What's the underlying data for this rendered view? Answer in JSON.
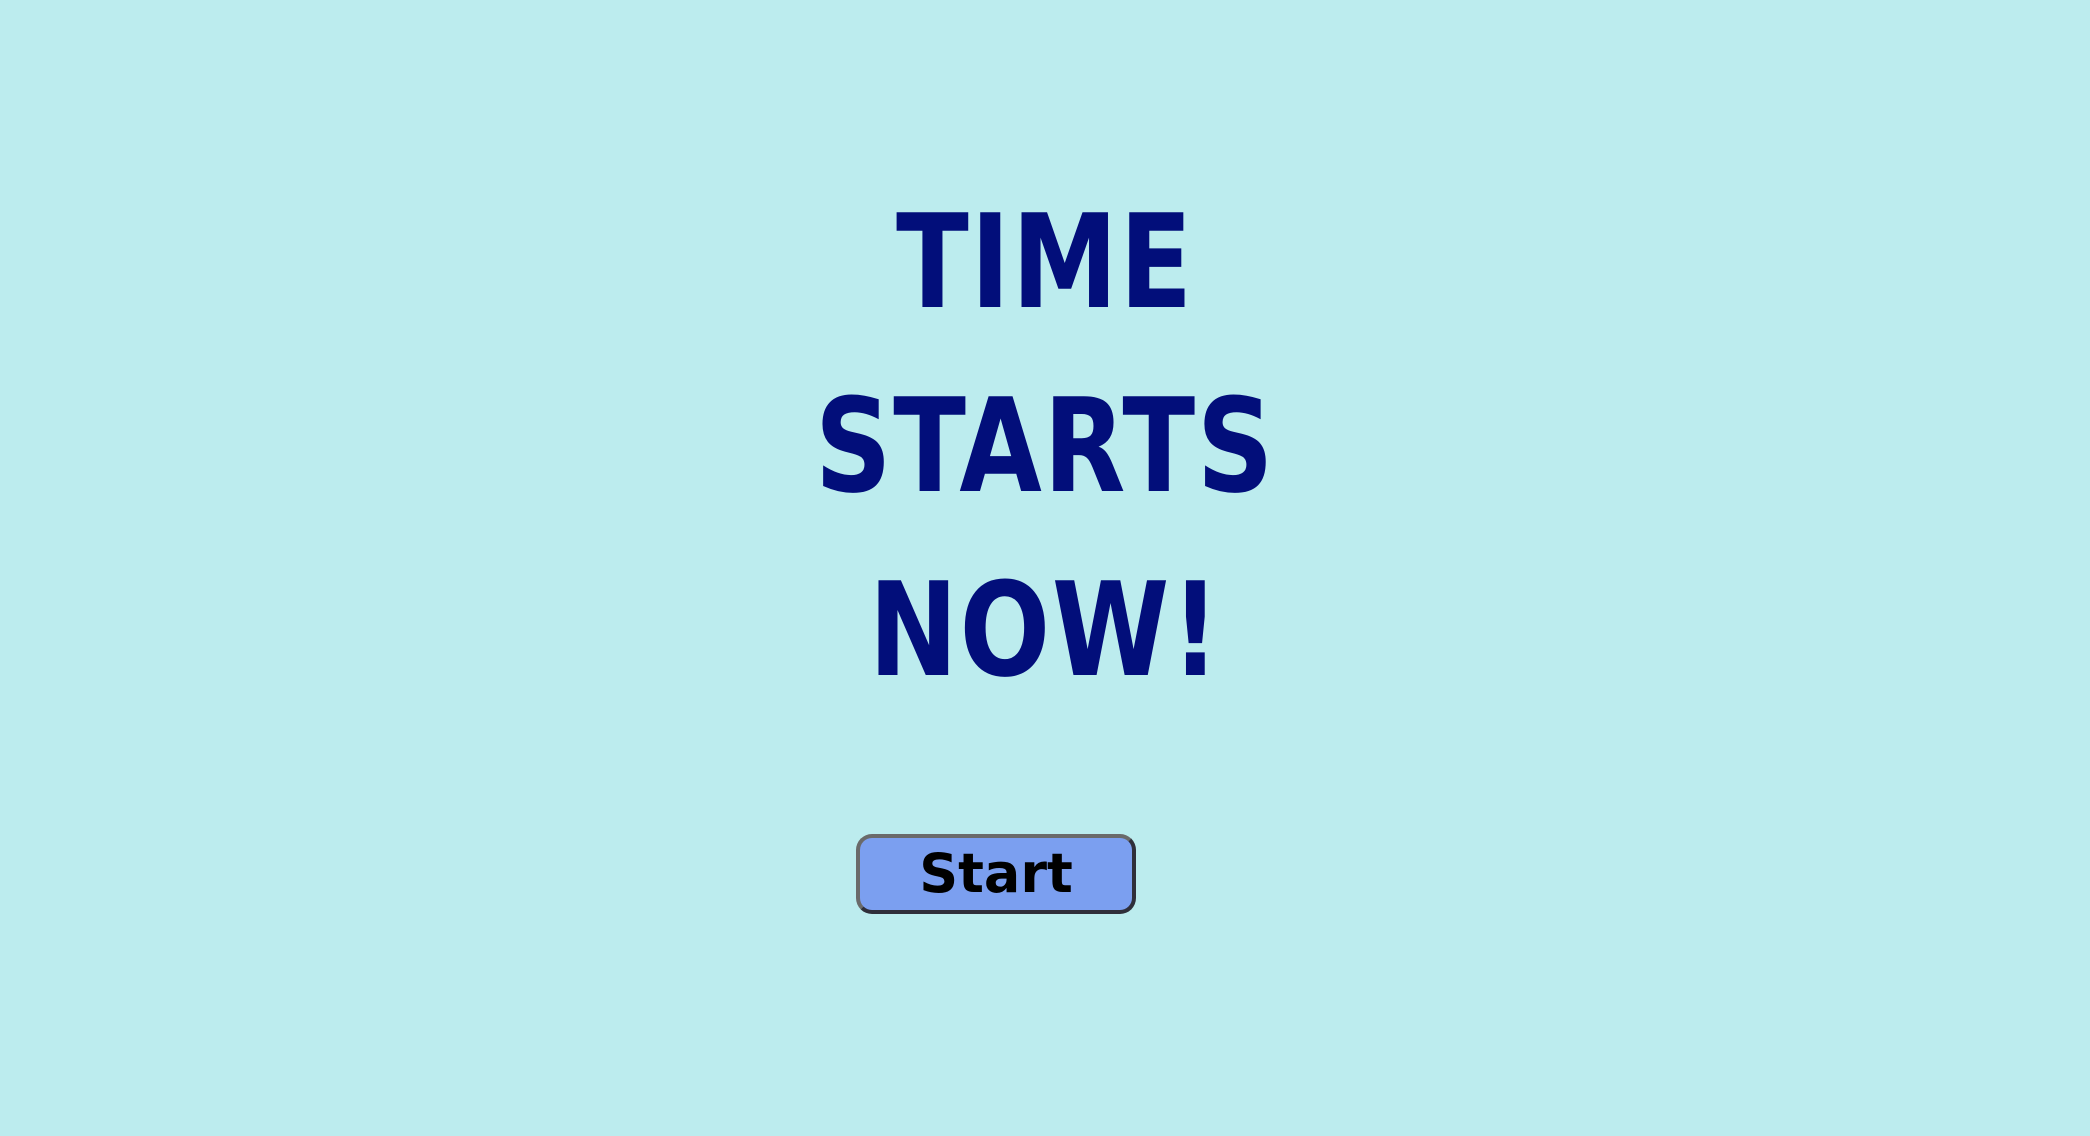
{
  "screen": {
    "background_color": "#bcecee",
    "title_lines": [
      "TIME",
      "STARTS",
      "NOW!"
    ],
    "title_color": "#020e7a"
  },
  "start_button": {
    "label": "Start",
    "background_color": "#7b9ff0"
  }
}
